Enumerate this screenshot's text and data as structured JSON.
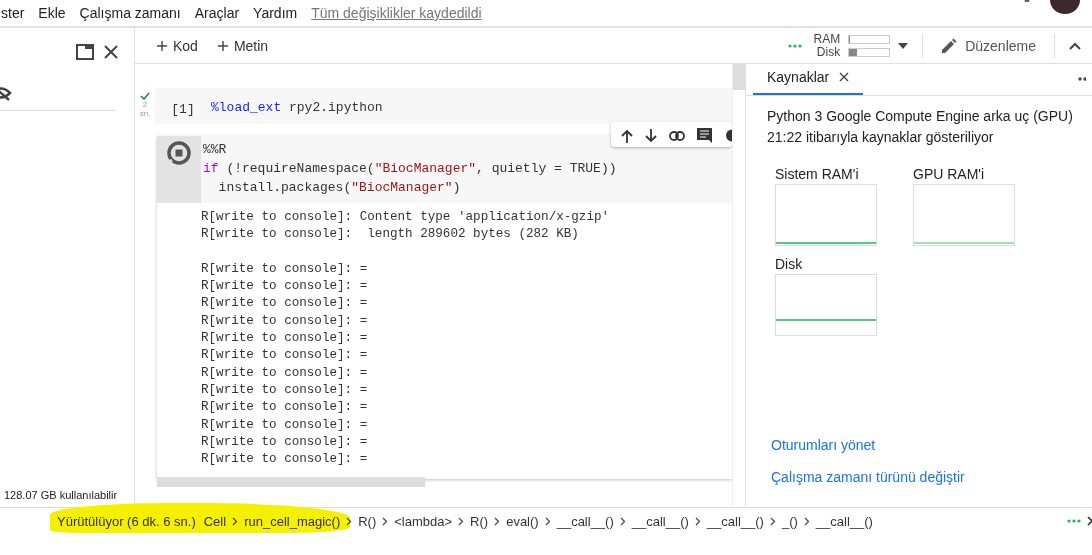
{
  "menu": {
    "items": [
      "ster",
      "Ekle",
      "Çalışma zamanı",
      "Araçlar",
      "Yardım"
    ],
    "save_status": "Tüm değişiklikler kaydedildi"
  },
  "toolbar": {
    "add_buttons": [
      "Kod",
      "Metin"
    ],
    "meters": [
      {
        "label": "RAM",
        "level": 0.02
      },
      {
        "label": "Disk",
        "level": 0.2
      }
    ],
    "edit_button": "Düzenleme"
  },
  "sidebar": {
    "disk_info": "128.07 GB kullanılabilir"
  },
  "cells": [
    {
      "kind": "done",
      "prompt": "[1]",
      "exec_time": "2",
      "exec_unit": "sn.",
      "code": [
        "%load_ext rpy2.ipython"
      ]
    },
    {
      "kind": "running",
      "code": [
        "%%R",
        "if (!requireNamespace(\"BiocManager\", quietly = TRUE))",
        "  install.packages(\"BiocManager\")"
      ],
      "output_blocks": [
        [
          "R[write to console]: Content type 'application/x-gzip'",
          "R[write to console]:  length 289602 bytes (282 KB)"
        ],
        [
          "R[write to console]: =",
          "R[write to console]: =",
          "R[write to console]: =",
          "R[write to console]: =",
          "R[write to console]: =",
          "R[write to console]: =",
          "R[write to console]: =",
          "R[write to console]: =",
          "R[write to console]: =",
          "R[write to console]: =",
          "R[write to console]: =",
          "R[write to console]: ="
        ]
      ]
    }
  ],
  "resources_panel": {
    "tabs": [
      {
        "label": "Kaynaklar",
        "selected": true
      }
    ],
    "runtime": "Python 3 Google Compute Engine arka uç (GPU)",
    "timestamp": "21:22 itibarıyla kaynaklar gösteriliyor",
    "charts": [
      {
        "label": "Sistem RAM'i"
      },
      {
        "label": "GPU RAM'i"
      },
      {
        "label": "Disk"
      }
    ],
    "links": [
      "Oturumları yönet",
      "Çalışma zamanı türünü değiştir"
    ]
  },
  "status_bar": {
    "state": "Yürütülüyor (6 dk. 6 sn.)",
    "stack": [
      "Cell",
      "run_cell_magic()",
      "R()",
      "<lambda>",
      "R()",
      "eval()",
      "__call__()",
      "__call__()",
      "__call__()",
      "_()",
      "__call__()"
    ]
  }
}
